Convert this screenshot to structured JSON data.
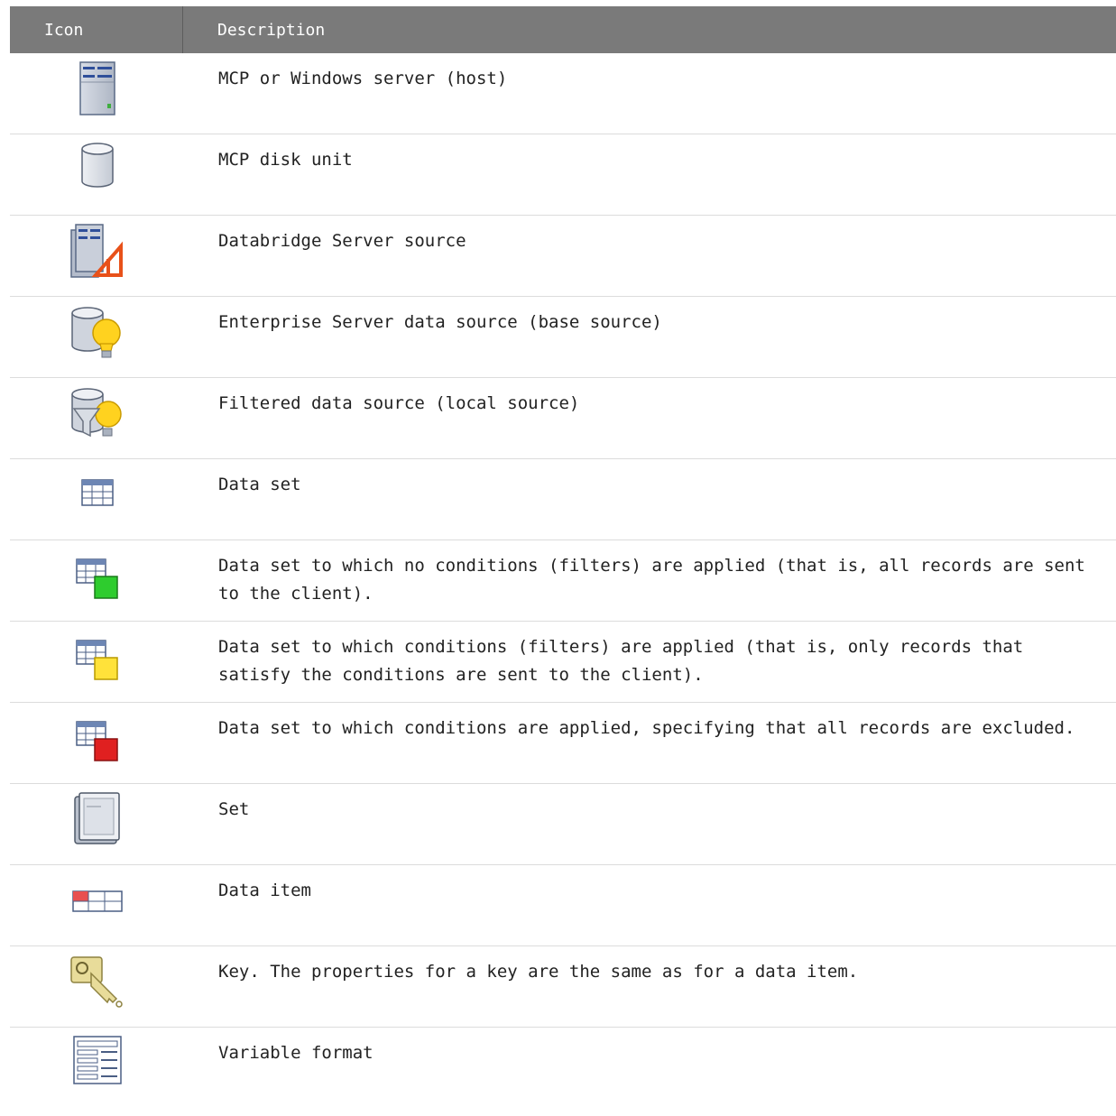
{
  "header": {
    "icon_col": "Icon",
    "desc_col": "Description"
  },
  "rows": [
    {
      "icon": "server-icon",
      "description": "MCP or Windows server (host)"
    },
    {
      "icon": "disk-unit-icon",
      "description": "MCP disk unit"
    },
    {
      "icon": "databridge-server-source-icon",
      "description": "Databridge Server source"
    },
    {
      "icon": "enterprise-data-source-icon",
      "description": "Enterprise Server data source (base source)"
    },
    {
      "icon": "filtered-data-source-icon",
      "description": "Filtered data source (local source)"
    },
    {
      "icon": "data-set-icon",
      "description": "Data set"
    },
    {
      "icon": "data-set-green-icon",
      "description": "Data set to which no conditions (filters) are applied (that is, all records are sent to the client)."
    },
    {
      "icon": "data-set-yellow-icon",
      "description": "Data set to which conditions (filters) are applied (that is, only records that satisfy the conditions are sent to the client)."
    },
    {
      "icon": "data-set-red-icon",
      "description": "Data set to which conditions are applied, specifying that all records are excluded."
    },
    {
      "icon": "set-icon",
      "description": "Set"
    },
    {
      "icon": "data-item-icon",
      "description": "Data item"
    },
    {
      "icon": "key-icon",
      "description": "Key. The properties for a key are the same as for a data item."
    },
    {
      "icon": "variable-format-icon",
      "description": "Variable format"
    }
  ],
  "colors": {
    "header_bg": "#7a7a7a",
    "header_text": "#ffffff",
    "row_divider": "#dcdcdc",
    "green": "#2ecc2e",
    "yellow": "#ffe23a",
    "red": "#e02020",
    "orange": "#e8511a"
  }
}
